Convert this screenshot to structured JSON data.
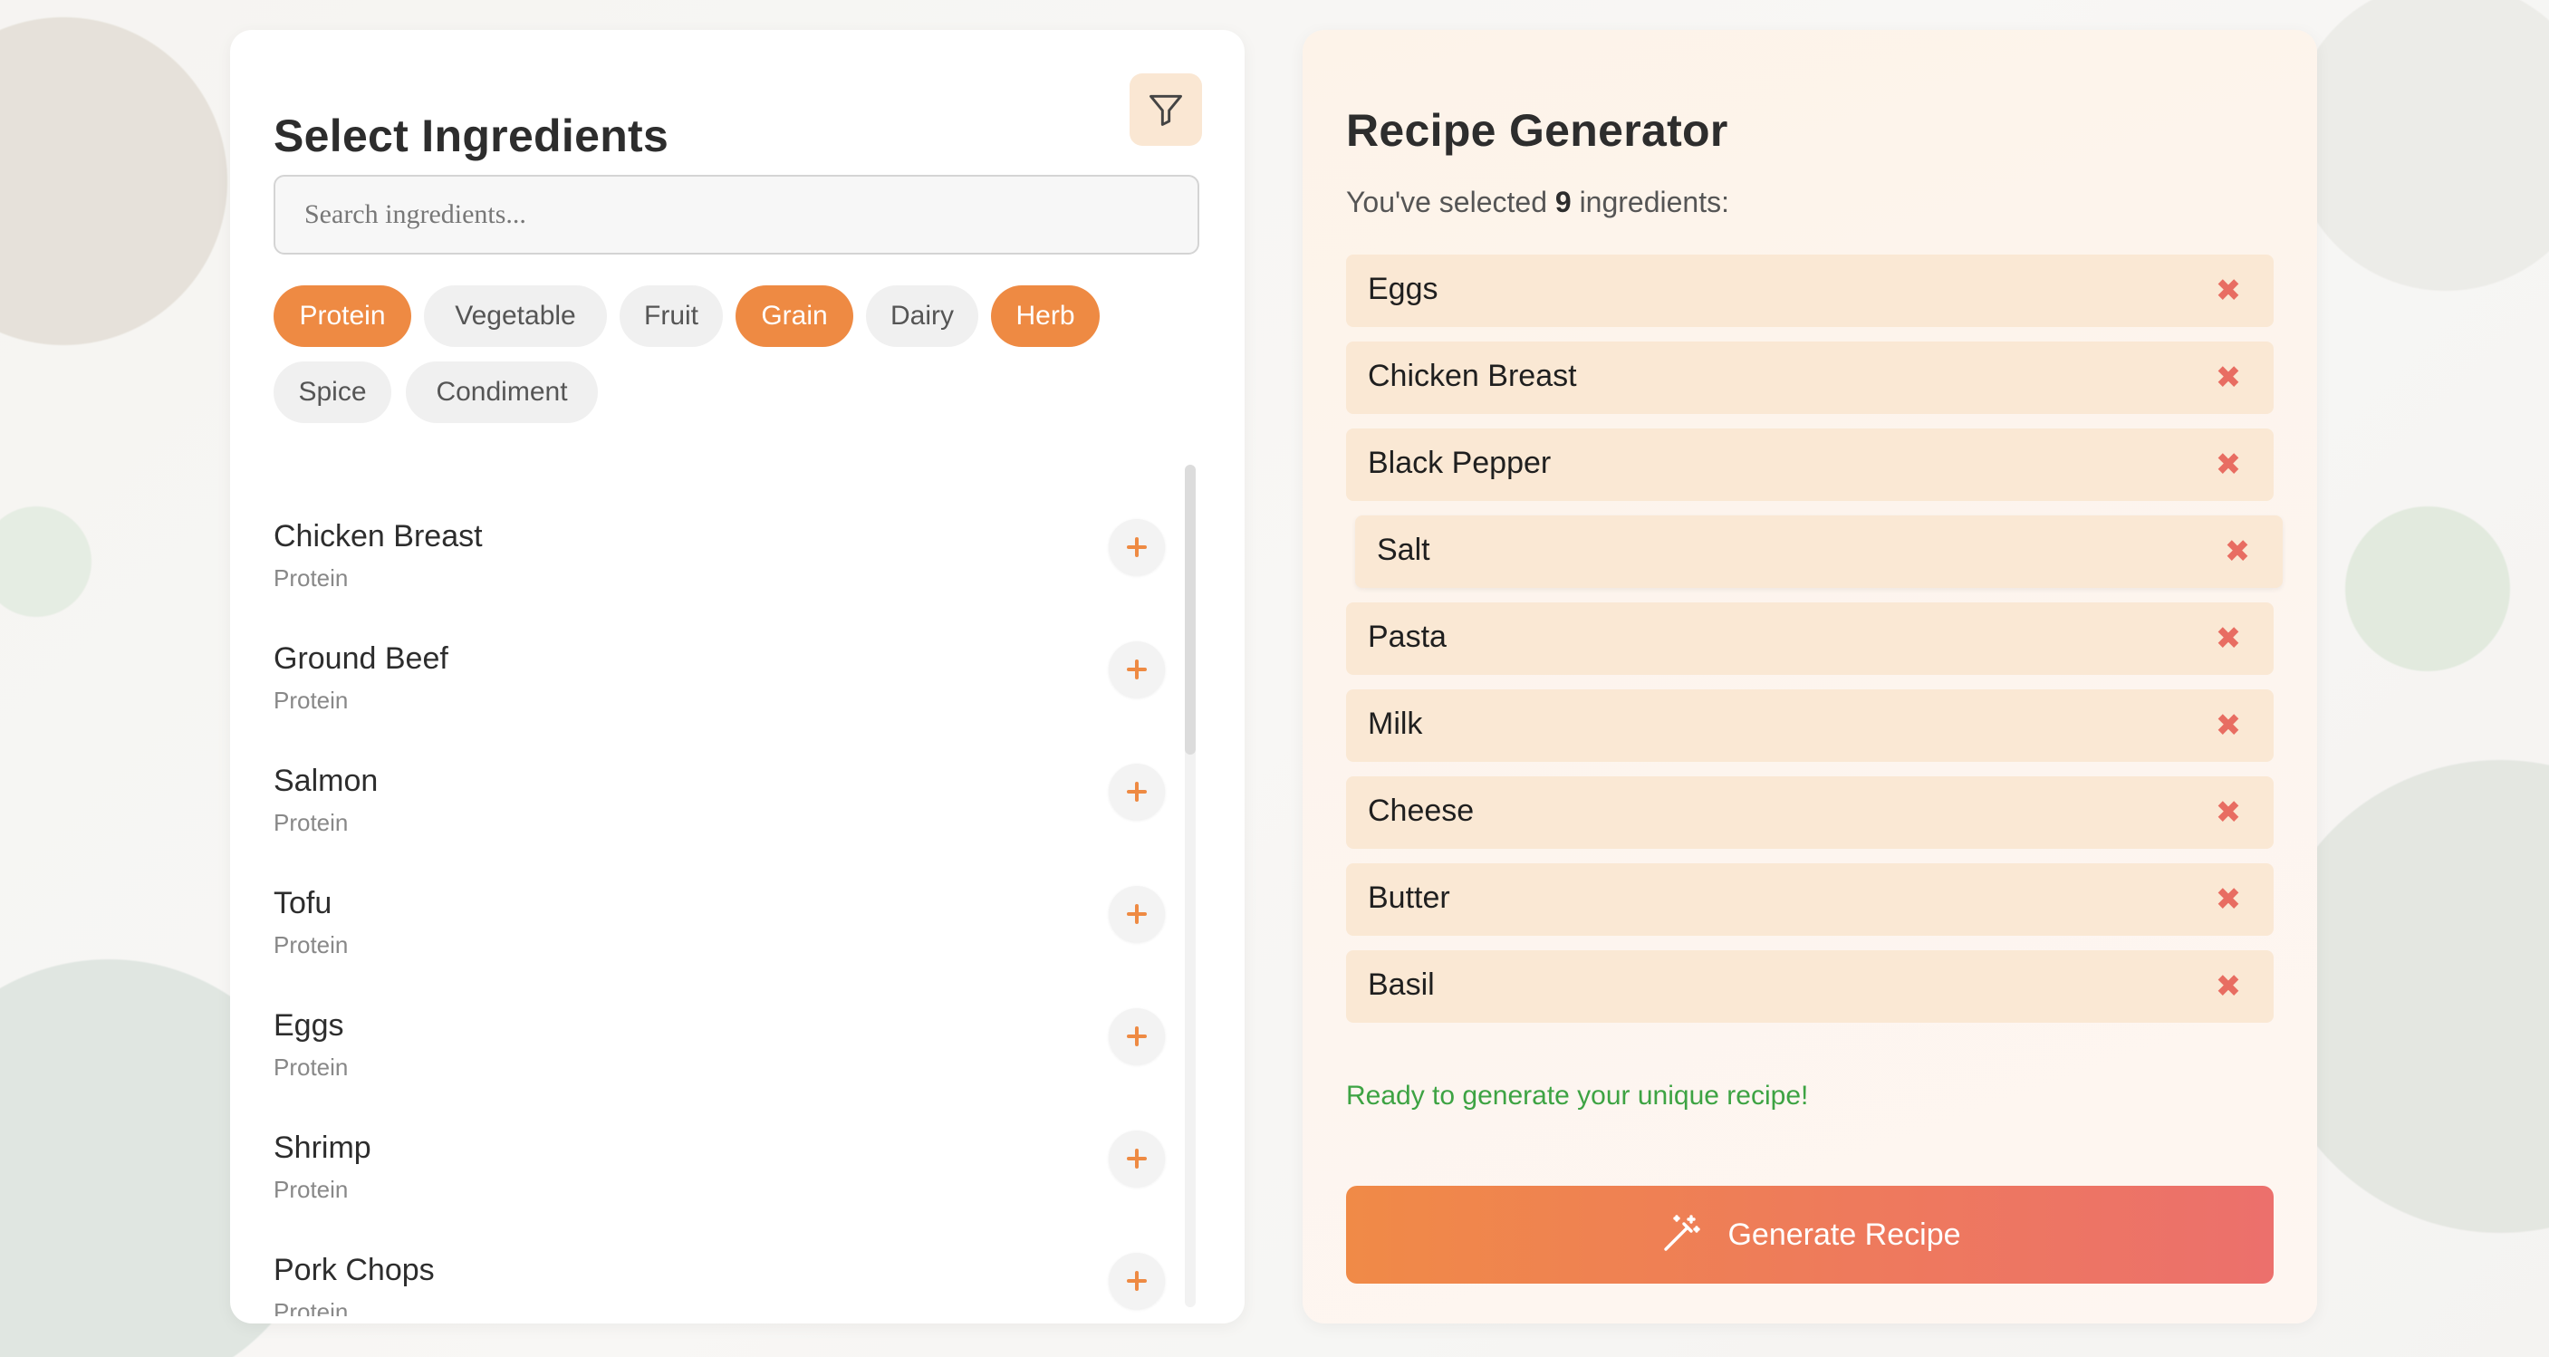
{
  "colors": {
    "accent": "#ee8a43",
    "remove": "#e86d62",
    "ready": "#3da343"
  },
  "left": {
    "title": "Select Ingredients",
    "filter_icon": "filter-icon",
    "search_placeholder": "Search ingredients...",
    "categories": [
      {
        "label": "Protein",
        "active": true
      },
      {
        "label": "Vegetable",
        "active": false
      },
      {
        "label": "Fruit",
        "active": false
      },
      {
        "label": "Grain",
        "active": true
      },
      {
        "label": "Dairy",
        "active": false
      },
      {
        "label": "Herb",
        "active": true
      },
      {
        "label": "Spice",
        "active": false
      },
      {
        "label": "Condiment",
        "active": false
      }
    ],
    "ingredients": [
      {
        "name": "Chicken Breast",
        "category": "Protein"
      },
      {
        "name": "Ground Beef",
        "category": "Protein"
      },
      {
        "name": "Salmon",
        "category": "Protein"
      },
      {
        "name": "Tofu",
        "category": "Protein"
      },
      {
        "name": "Eggs",
        "category": "Protein"
      },
      {
        "name": "Shrimp",
        "category": "Protein"
      },
      {
        "name": "Pork Chops",
        "category": "Protein"
      }
    ]
  },
  "right": {
    "title": "Recipe Generator",
    "summary_prefix": "You've selected",
    "count": "9",
    "summary_suffix": "ingredients:",
    "selected": [
      "Eggs",
      "Chicken Breast",
      "Black Pepper",
      "Salt",
      "Pasta",
      "Milk",
      "Cheese",
      "Butter",
      "Basil"
    ],
    "ready_text": "Ready to generate your unique recipe!",
    "generate_label": "Generate Recipe",
    "generate_icon": "magic-wand-icon"
  }
}
